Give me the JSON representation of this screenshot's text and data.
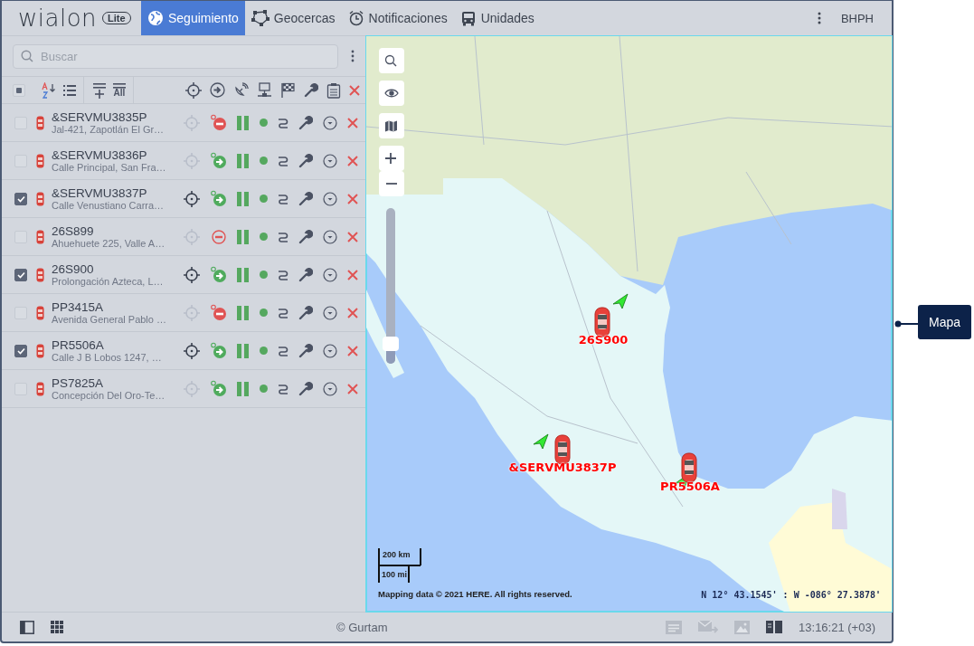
{
  "header": {
    "logo": "wialon",
    "logo_badge": "Lite",
    "tabs": [
      {
        "label": "Seguimiento",
        "selected": true,
        "kind": "globe"
      },
      {
        "label": "Geocercas",
        "selected": false,
        "kind": "polygon"
      },
      {
        "label": "Notificaciones",
        "selected": false,
        "kind": "alarm"
      },
      {
        "label": "Unidades",
        "selected": false,
        "kind": "bus"
      }
    ],
    "user": "BHPH"
  },
  "search": {
    "placeholder": "Buscar"
  },
  "toolbar": {
    "select_all_partial": true,
    "all_label": "All"
  },
  "units": [
    {
      "name": "&SERVMU3835P",
      "address": "Jal-421, Zapotlán El Gr…",
      "checked": false,
      "kind": "stop"
    },
    {
      "name": "&SERVMU3836P",
      "address": "Calle Principal, San Fra…",
      "checked": false,
      "kind": "go"
    },
    {
      "name": "&SERVMU3837P",
      "address": "Calle Venustiano Carra…",
      "checked": true,
      "kind": "go"
    },
    {
      "name": "26S899",
      "address": "Ahuehuete 225, Valle A…",
      "checked": false,
      "kind": "off"
    },
    {
      "name": "26S900",
      "address": "Prolongación Azteca, L…",
      "checked": true,
      "kind": "go"
    },
    {
      "name": "PP3415A",
      "address": "Avenida General Pablo …",
      "checked": false,
      "kind": "stop"
    },
    {
      "name": "PR5506A",
      "address": "Calle J B Lobos 1247, …",
      "checked": true,
      "kind": "go"
    },
    {
      "name": "PS7825A",
      "address": "Concepción Del Oro-Te…",
      "checked": false,
      "kind": "go"
    }
  ],
  "map": {
    "zoom": {
      "level": 0.13
    },
    "markers": [
      {
        "label": "26S900"
      },
      {
        "label": "&SERVMU3837P"
      },
      {
        "label": "PR5506A"
      }
    ],
    "scale": {
      "metric": "200 km",
      "imperial": "100 mi"
    },
    "copyright": "Mapping data © 2021 HERE. All rights reserved.",
    "coordinates": "N 12° 43.1545' : W -086° 27.3878'"
  },
  "footer": {
    "copyright": "© Gurtam",
    "time": "13:16:21 (+03)"
  },
  "callout": {
    "label": "Mapa"
  }
}
